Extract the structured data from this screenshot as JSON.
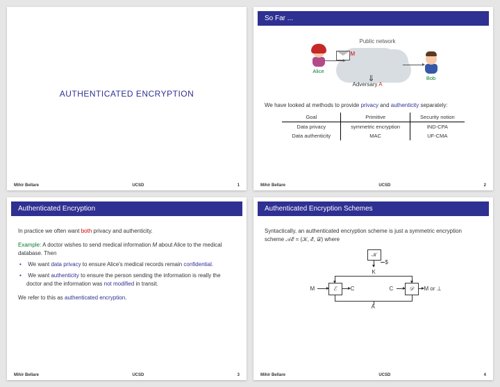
{
  "footer": {
    "author": "Mihir Bellare",
    "inst": "UCSD"
  },
  "slide1": {
    "title": "AUTHENTICATED ENCRYPTION",
    "page": "1"
  },
  "slide2": {
    "title": "So Far ...",
    "page": "2",
    "pubnet": "Public network",
    "alice": "Alice",
    "bob": "Bob",
    "adversary_pre": "Adversary ",
    "adversary_A": "A",
    "m_label": "M",
    "intro_a": "We have looked at methods to provide ",
    "privacy": "privacy",
    "intro_b": " and ",
    "auth": "authenticity",
    "intro_c": " separately:",
    "th0": "Goal",
    "th1": "Primitive",
    "th2": "Security notion",
    "r1c0": "Data privacy",
    "r1c1": "symmetric encryption",
    "r1c2": "IND-CPA",
    "r2c0": "Data authenticity",
    "r2c1": "MAC",
    "r2c2": "UF-CMA"
  },
  "slide3": {
    "title": "Authenticated Encryption",
    "page": "3",
    "p1a": "In practice we often want ",
    "both": "both",
    "p1b": " privacy and authenticity.",
    "ex_label": "Example:",
    "ex_a": " A doctor wishes to send medical information ",
    "ex_M": "M",
    "ex_b": " about Alice to the medical database. Then",
    "b1a": "We want ",
    "b1b": "data privacy",
    "b1c": " to ensure Alice's medical records remain ",
    "b1d": "confidential",
    "b1e": ".",
    "b2a": "We want ",
    "b2b": "authenticity",
    "b2c": " to ensure the person sending the information is really the doctor and the information was ",
    "b2d": "not modified",
    "b2e": " in transit.",
    "p3a": "We refer to this as ",
    "p3b": "authenticated encryption",
    "p3c": "."
  },
  "slide4": {
    "title": "Authenticated Encryption Schemes",
    "page": "4",
    "p1": "Syntactically, an authenticated encryption scheme is just a symmetric encryption scheme 𝒜ℰ = (𝒦, ℰ, 𝒟) where",
    "Kbox": "𝒦",
    "Ebox": "ℰ",
    "Dbox": "𝒟",
    "dollar": "$",
    "K": "K",
    "M": "M",
    "C": "C",
    "Mout": "M or ⊥",
    "A": "A"
  }
}
